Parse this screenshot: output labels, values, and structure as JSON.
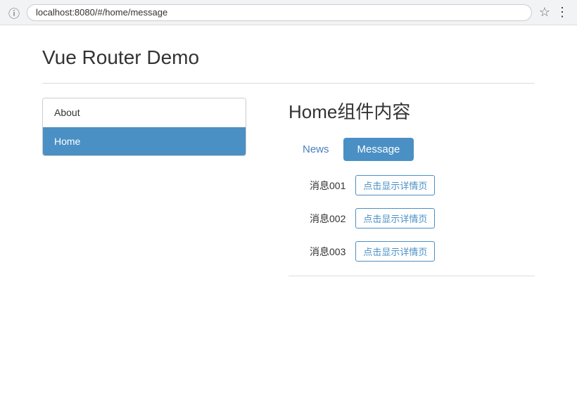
{
  "browser": {
    "url": "localhost:8080/#/home/message",
    "star_icon": "⭐",
    "menu_icon": "⋮",
    "info_icon": "ⓘ"
  },
  "page": {
    "title": "Vue Router Demo"
  },
  "nav": {
    "items": [
      {
        "label": "About",
        "active": false
      },
      {
        "label": "Home",
        "active": true
      }
    ]
  },
  "home": {
    "title": "Home组件内容",
    "tabs": [
      {
        "label": "News",
        "active": false
      },
      {
        "label": "Message",
        "active": true
      }
    ],
    "messages": [
      {
        "text": "消息001",
        "btn_label": "点击显示详情页"
      },
      {
        "text": "消息002",
        "btn_label": "点击显示详情页"
      },
      {
        "text": "消息003",
        "btn_label": "点击显示详情页"
      }
    ]
  }
}
